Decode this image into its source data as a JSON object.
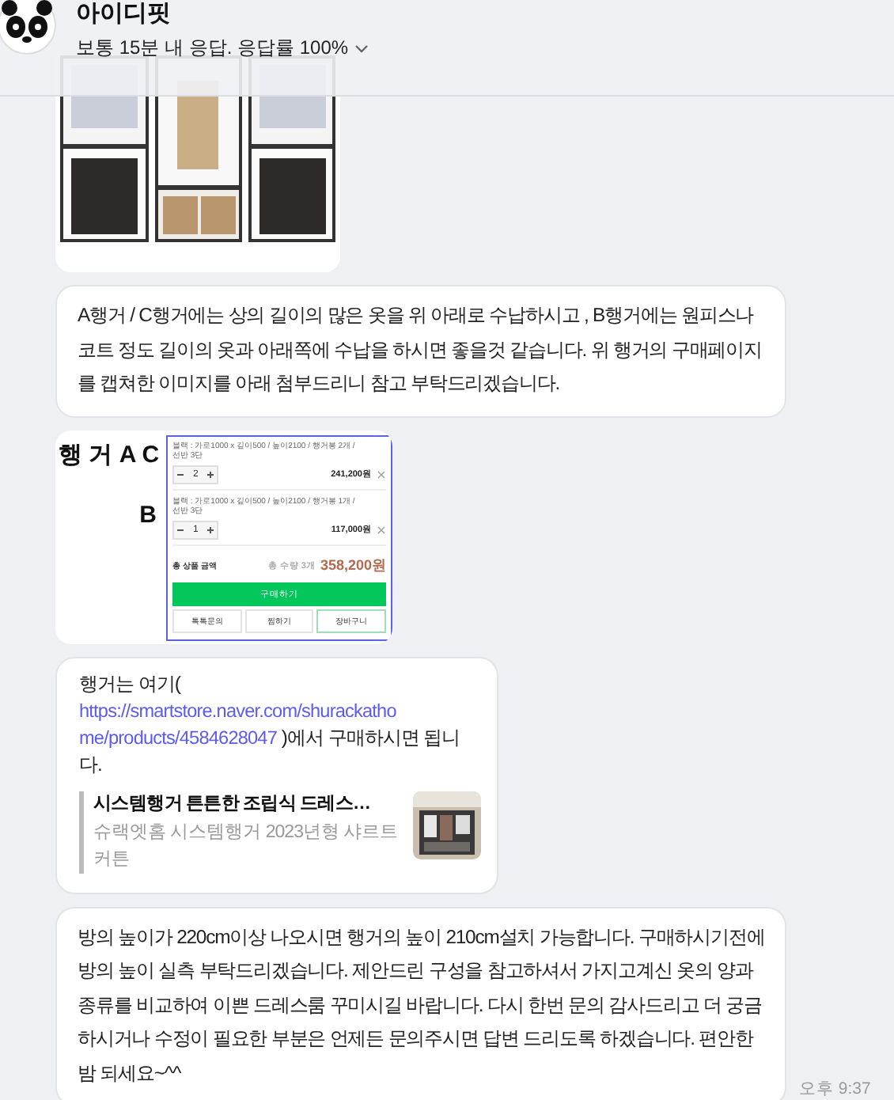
{
  "header": {
    "name": "아이디핏",
    "status": "보통 15분 내 응답. 응답률 100%"
  },
  "messages": [
    {
      "kind": "picture"
    },
    {
      "kind": "text",
      "text": "A행거 / C행거에는 상의 길이의 많은 옷을 위 아래로 수납하시고 , B행거에는 원피스나 코트 정도 길이의 옷과 아래쪽에 수납을 하시면 좋을것 같습니다. 위 행거의 구매페이지를 캡쳐한 이미지를 아래 첨부드리니 참고 부탁드리겠습니다."
    },
    {
      "kind": "screenshot",
      "labels": [
        "행 거 A C",
        "B"
      ],
      "items": [
        {
          "option": "블랙 : 가로1000 x 깊이500 / 높이2100 / 행거봉 2개 / 선반 3단",
          "quantity": "2",
          "price": "241,200원"
        },
        {
          "option": "블랙 : 가로1000 x 깊이500 / 높이2100 / 행거봉 1개 / 선반 3단",
          "quantity": "1",
          "price": "117,000원"
        }
      ],
      "total_label": "총 상품 금액",
      "total_count": "총 수량 3개",
      "total": "358,200원",
      "buy_button": "구매하기",
      "actions": [
        "톡톡문의",
        "찜하기",
        "장바구니"
      ]
    },
    {
      "kind": "link",
      "text_before": "행거는 여기(",
      "url_lines": [
        "https://smartstore.naver.com/shurackatho",
        "me/products/4584628047"
      ],
      "text_after": " )에서 구매하시면 됩니다.",
      "preview": {
        "title": "시스템행거 튼튼한 조립식 드레스…",
        "description": "슈랙엣홈 시스템행거 2023년형 샤르트 커튼"
      }
    },
    {
      "kind": "text",
      "text": "방의 높이가 220cm이상 나오시면 행거의 높이 210cm설치 가능합니다. 구매하시기전에 방의 높이 실측 부탁드리겠습니다. 제안드린 구성을 참고하셔서 가지고계신 옷의 양과 종류를 비교하여 이쁜 드레스룸 꾸미시길 바랍니다. 다시 한번 문의 감사드리고 더 궁금하시거나 수정이 필요한 부분은 언제든 문의주시면 답변 드리도록 하겠습니다. 편안한 밤 되세요~^^",
      "time": "오후 9:37"
    }
  ]
}
